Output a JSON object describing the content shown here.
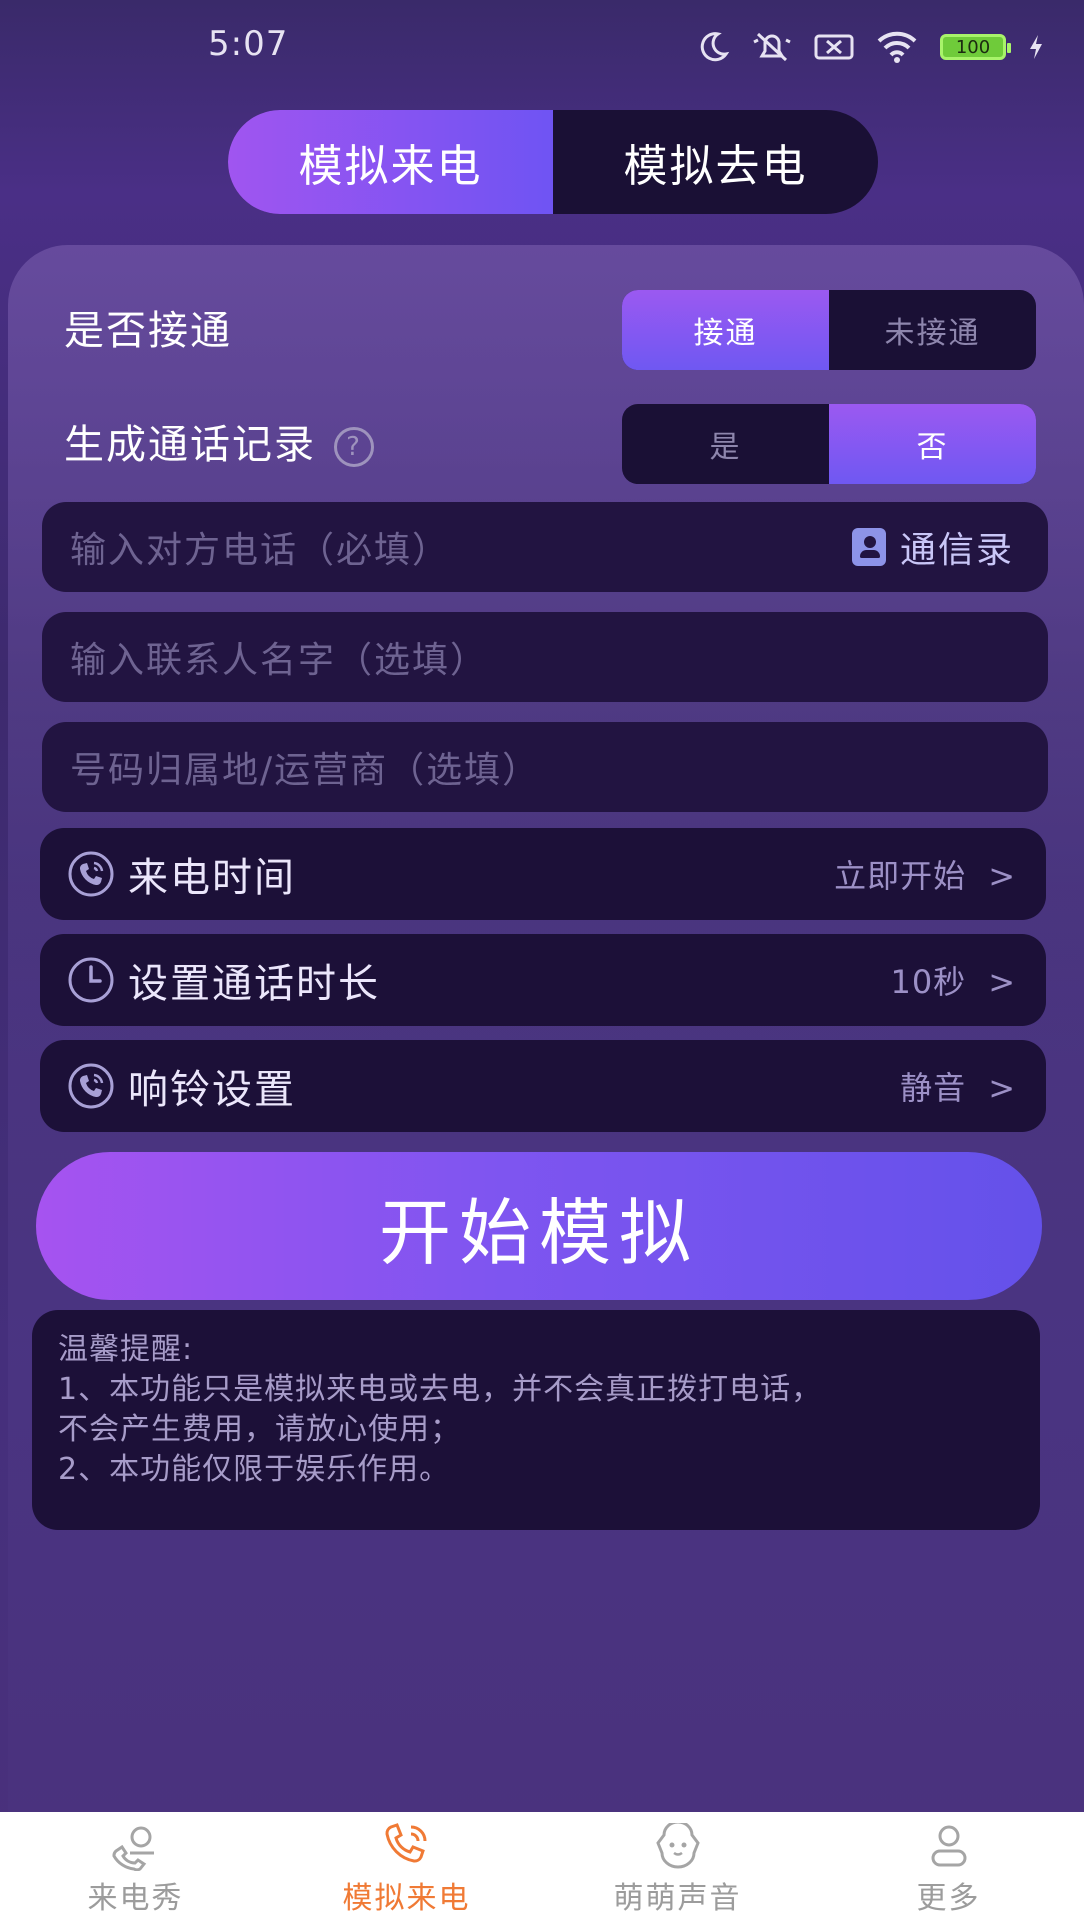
{
  "status_bar": {
    "time": "5:07",
    "battery": "100"
  },
  "top_tabs": [
    {
      "label": "模拟来电",
      "active": true
    },
    {
      "label": "模拟去电",
      "active": false
    }
  ],
  "answer_row": {
    "label": "是否接通",
    "options": [
      "接通",
      "未接通"
    ],
    "selected": "接通"
  },
  "record_row": {
    "label": "生成通话记录",
    "help": "?",
    "options": [
      "是",
      "否"
    ],
    "selected": "否"
  },
  "inputs": {
    "phone_placeholder": "输入对方电话（必填）",
    "contacts_label": "通信录",
    "name_placeholder": "输入联系人名字（选填）",
    "carrier_placeholder": "号码归属地/运营商（选填）"
  },
  "settings": {
    "call_time": {
      "label": "来电时间",
      "value": "立即开始",
      "chevron": ">"
    },
    "duration": {
      "label": "设置通话时长",
      "value": "10秒",
      "chevron": ">"
    },
    "ringtone": {
      "label": "响铃设置",
      "value": "静音",
      "chevron": ">"
    }
  },
  "start_button": "开始模拟",
  "tips": {
    "title": "温馨提醒:",
    "line1": "1、本功能只是模拟来电或去电，并不会真正拨打电话，",
    "line2": "不会产生费用，请放心使用；",
    "line3": "2、本功能仅限于娱乐作用。"
  },
  "bottom_nav": [
    {
      "label": "来电秀",
      "icon": "call-show-icon",
      "active": false
    },
    {
      "label": "模拟来电",
      "icon": "phone-call-icon",
      "active": true
    },
    {
      "label": "萌萌声音",
      "icon": "puppy-icon",
      "active": false
    },
    {
      "label": "更多",
      "icon": "user-icon",
      "active": false
    }
  ],
  "colors": {
    "accent_gradient_start": "#a055f0",
    "accent_gradient_end": "#6f54f3",
    "nav_active": "#f07a35"
  }
}
